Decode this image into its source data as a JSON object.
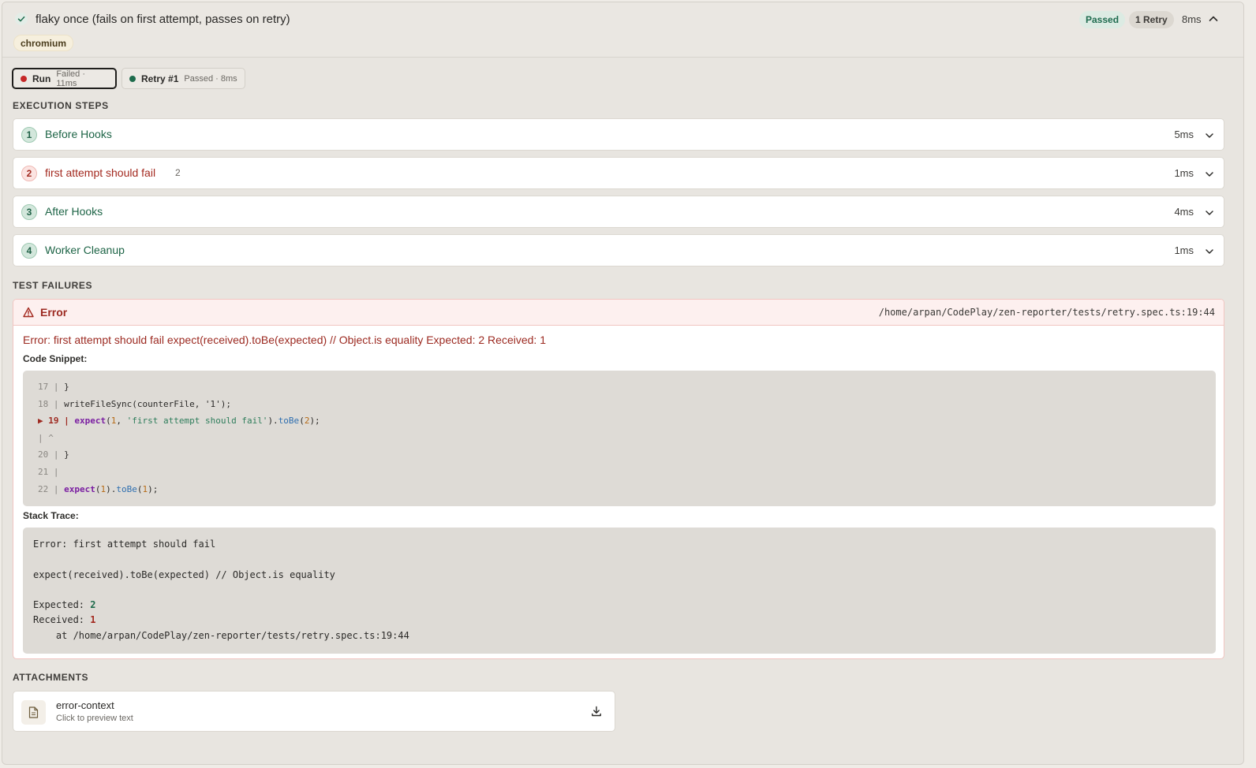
{
  "header": {
    "title": "flaky once (fails on first attempt, passes on retry)",
    "browser_tag": "chromium",
    "status": "Passed",
    "retries": "1 Retry",
    "duration": "8ms"
  },
  "tabs": [
    {
      "name": "Run",
      "meta": "Failed · 11ms",
      "status_color": "#c62828"
    },
    {
      "name": "Retry #1",
      "meta": "Passed · 8ms",
      "status_color": "#1e6b4c"
    }
  ],
  "steps_section": {
    "title": "EXECUTION STEPS",
    "steps": [
      {
        "num": "1",
        "label": "Before Hooks",
        "time": "5ms",
        "status": "ok"
      },
      {
        "num": "2",
        "label": "first attempt should fail",
        "count": "2",
        "time": "1ms",
        "status": "bad"
      },
      {
        "num": "3",
        "label": "After Hooks",
        "time": "4ms",
        "status": "ok"
      },
      {
        "num": "4",
        "label": "Worker Cleanup",
        "time": "1ms",
        "status": "ok"
      }
    ]
  },
  "failures_section": {
    "title": "TEST FAILURES",
    "error_label": "Error",
    "error_path": "/home/arpan/CodePlay/zen-reporter/tests/retry.spec.ts:19:44",
    "error_message": "Error: first attempt should fail expect(received).toBe(expected) // Object.is equality Expected: 2 Received: 1",
    "code_snippet_label": "Code Snippet:",
    "code_lines": {
      "l17_num": "17 |",
      "l17_code": "}",
      "l18_num": "18 |",
      "l18_code": "writeFileSync(counterFile, '1');",
      "l19_marker": "▶ 19 |",
      "l19_kw": "expect",
      "l19_p1": "(",
      "l19_n1": "1",
      "l19_p2": ", ",
      "l19_str": "'first attempt should fail'",
      "l19_p3": ").",
      "l19_fn": "toBe",
      "l19_p4": "(",
      "l19_n2": "2",
      "l19_p5": ");",
      "caret": "| ^",
      "l20_num": "20 |",
      "l20_code": "}",
      "l21_num": "21 |",
      "l22_num": "22 |",
      "l22_kw": "expect",
      "l22_p1": "(",
      "l22_n1": "1",
      "l22_p2": ").",
      "l22_fn": "toBe",
      "l22_p3": "(",
      "l22_n2": "1",
      "l22_p4": ");"
    },
    "stack_trace_label": "Stack Trace:",
    "stack": {
      "line1": "Error: first attempt should fail",
      "line2": "expect(received).toBe(expected) // Object.is equality",
      "expected_label": "Expected: ",
      "expected_value": "2",
      "received_label": "Received: ",
      "received_value": "1",
      "at_line": "    at /home/arpan/CodePlay/zen-reporter/tests/retry.spec.ts:19:44"
    }
  },
  "attachments_section": {
    "title": "ATTACHMENTS",
    "items": [
      {
        "name": "error-context",
        "hint": "Click to preview text"
      }
    ]
  }
}
